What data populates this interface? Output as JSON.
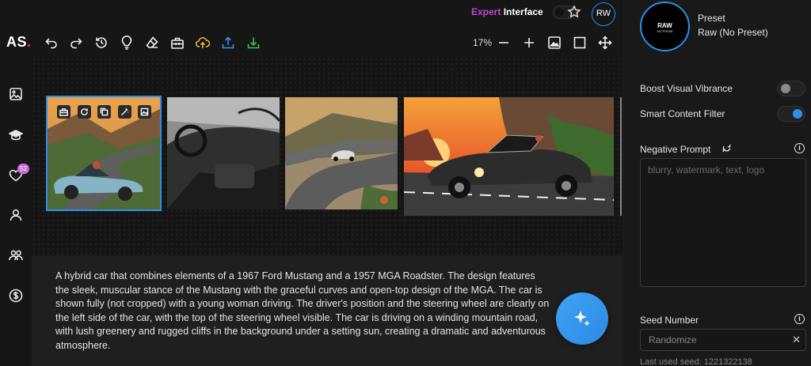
{
  "app": {
    "logo": "AS",
    "logo_dot": "."
  },
  "sidebar": {
    "items": [
      {
        "name": "images",
        "icon": "image-icon"
      },
      {
        "name": "learn",
        "icon": "graduation-cap-icon"
      },
      {
        "name": "favorites",
        "icon": "heart-icon",
        "badge": "52"
      },
      {
        "name": "profile",
        "icon": "user-icon"
      },
      {
        "name": "community",
        "icon": "users-icon"
      },
      {
        "name": "billing",
        "icon": "dollar-icon"
      }
    ]
  },
  "header": {
    "mode_prefix": "Expert",
    "mode_suffix": "Interface",
    "avatar_initials": "RW"
  },
  "toolbar": {
    "tools": [
      "undo-icon",
      "redo-icon",
      "history-icon",
      "lightbulb-icon",
      "eraser-icon",
      "toolbox-icon",
      "cloud-upload-icon",
      "upload-icon",
      "download-icon"
    ],
    "zoom": "17%",
    "right_tools": [
      "zoom-out-icon",
      "zoom-in-icon",
      "image-icon",
      "square-icon",
      "move-icon"
    ]
  },
  "prompt": {
    "text": "A hybrid car that combines elements of a 1967 Ford Mustang and a 1957 MGA Roadster. The design features the sleek, muscular stance of the Mustang with the graceful curves and open-top design of the MGA. The car is shown fully (not cropped) with a young woman driving. The driver's position and the steering wheel are clearly on the left side of the car, with the top of the steering wheel visible. The car is driving on a winding mountain road, with lush greenery and rugged cliffs in the background under a setting sun, creating a dramatic and adventurous atmosphere."
  },
  "panel": {
    "preset": {
      "thumb_title": "RAW",
      "thumb_sub": "No Preset",
      "label": "Preset",
      "value": "Raw (No Preset)"
    },
    "boost_label": "Boost Visual Vibrance",
    "boost_on": false,
    "filter_label": "Smart Content Filter",
    "filter_on": true,
    "negative_label": "Negative Prompt",
    "negative_placeholder": "blurry, watermark, text, logo",
    "seed_label": "Seed Number",
    "seed_placeholder": "Randomize",
    "last_seed": "Last used seed: 1221322138"
  },
  "colors": {
    "accent": "#2d8fe6",
    "expert": "#c844d6",
    "badge": "#c86bd7"
  }
}
